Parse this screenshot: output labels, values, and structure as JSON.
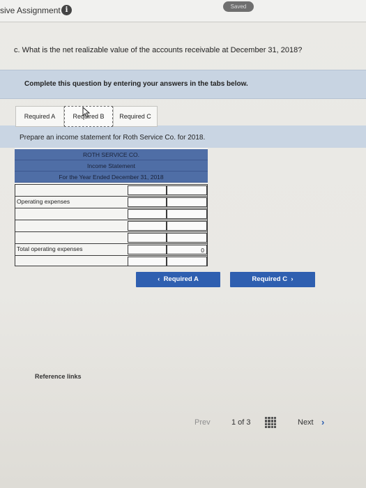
{
  "header": {
    "title": "sive Assignment",
    "info_icon": "i",
    "saved_label": "Saved"
  },
  "question": "c. What is the net realizable value of the accounts receivable at December 31, 2018?",
  "instructions": "Complete this question by entering your answers in the tabs below.",
  "tabs": [
    {
      "label": "Required A"
    },
    {
      "label": "Required B",
      "active": true
    },
    {
      "label": "Required C"
    }
  ],
  "prompt": "Prepare an income statement for Roth Service Co. for 2018.",
  "statement": {
    "company": "ROTH SERVICE CO.",
    "name": "Income Statement",
    "period": "For the Year Ended December 31, 2018",
    "rows": [
      {
        "label": "",
        "col1": "",
        "col2": ""
      },
      {
        "label": "Operating expenses",
        "col1": "",
        "col2": ""
      },
      {
        "label": "",
        "col1": "",
        "col2": ""
      },
      {
        "label": "",
        "col1": "",
        "col2": ""
      },
      {
        "label": "",
        "col1": "",
        "col2": ""
      },
      {
        "label": "Total operating expenses",
        "col1": "",
        "col2": "0"
      },
      {
        "label": "",
        "col1": "",
        "col2": ""
      }
    ],
    "header_color": "#4f6ea6"
  },
  "nav": {
    "prev_button": "Required A",
    "next_button": "Required C",
    "prev_icon": "chevron-left-icon",
    "next_icon": "chevron-right-icon",
    "accent": "#2f5fb0"
  },
  "reference_links": "Reference links",
  "pager": {
    "prev": "Prev",
    "count": "1 of 3",
    "next": "Next"
  }
}
